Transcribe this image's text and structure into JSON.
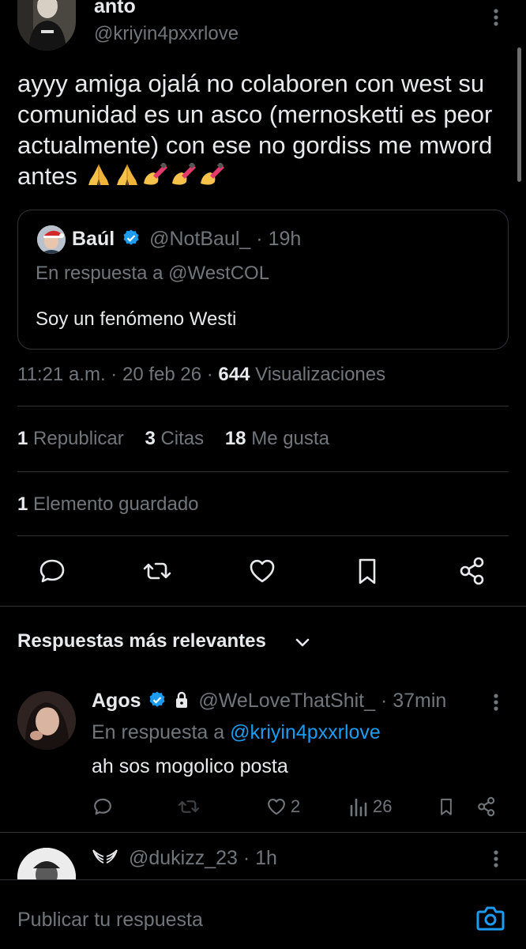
{
  "tweet": {
    "author_name": "anto",
    "author_handle": "@kriyin4pxxrlove",
    "text": "ayyy amiga ojalá no colaboren con west su comunidad es un asco (mernosketti es peor actualmente) con ese no gordiss me mword antes",
    "emojis": [
      "folded-hands",
      "folded-hands",
      "nail-polish",
      "nail-polish",
      "nail-polish"
    ],
    "time": "11:21 a.m.",
    "date": "20 feb 26",
    "views_count": "644",
    "views_label": "Visualizaciones",
    "reposts_count": "1",
    "reposts_label": "Republicar",
    "quotes_count": "3",
    "quotes_label": "Citas",
    "likes_count": "18",
    "likes_label": "Me gusta",
    "saved_count": "1",
    "saved_label": "Elemento guardado"
  },
  "quote": {
    "name": "Baúl",
    "handle": "@NotBaul_",
    "age": "19h",
    "in_reply_prefix": "En respuesta a",
    "in_reply_to": "@WestCOL",
    "text": "Soy un fenómeno Westi"
  },
  "replies_header": "Respuestas más relevantes",
  "replies": [
    {
      "name": "Agos",
      "handle": "@WeLoveThatShit_",
      "age": "37min",
      "in_reply_prefix": "En respuesta a",
      "in_reply_to": "@kriyin4pxxrlove",
      "text": "ah sos mogolico posta",
      "likes": "2",
      "views": "26"
    },
    {
      "handle": "@dukizz_23",
      "age": "1h"
    }
  ],
  "composer": {
    "placeholder": "Publicar tu respuesta"
  },
  "separator": "·",
  "colors": {
    "background": "#000000",
    "text": "#e7e9ea",
    "muted": "#71767b",
    "accent": "#1d9bf0",
    "divider": "#2f3336"
  }
}
